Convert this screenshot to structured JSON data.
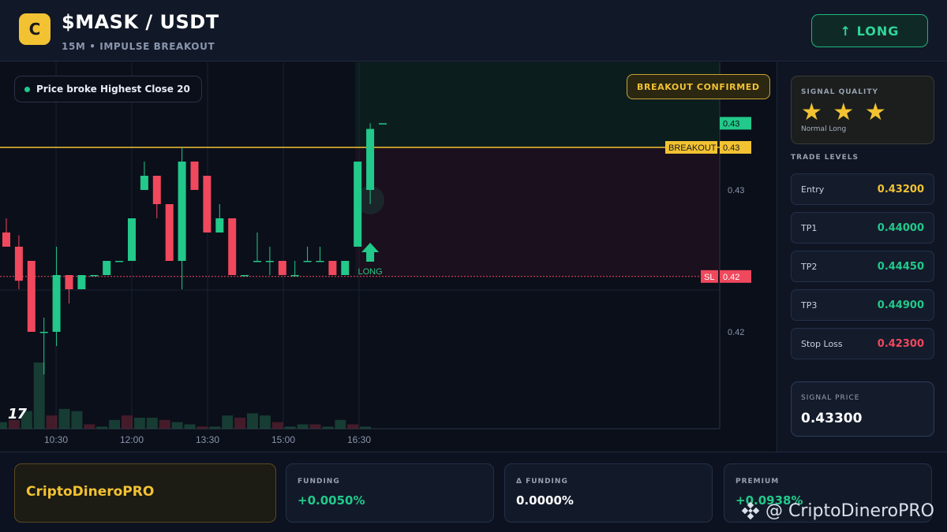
{
  "header": {
    "logo_letter": "C",
    "pair": "$MASK / USDT",
    "subtitle": "15M • IMPULSE BREAKOUT",
    "long_button": "↑ LONG"
  },
  "chart": {
    "status_pill": "Price broke Highest Close 20",
    "breakout_badge": "BREAKOUT CONFIRMED",
    "long_marker": "LONG",
    "tv_logo": "17",
    "price_labels": {
      "last": "0.43",
      "breakout_name": "BREAKOUT",
      "breakout_value": "0.43",
      "sl_name": "SL",
      "sl_value": "0.42"
    },
    "colors": {
      "up": "#22c98a",
      "down": "#f0485d",
      "breakout": "#f2c232",
      "sl": "#f0485d"
    }
  },
  "chart_data": {
    "type": "candlestick",
    "y_ticks": [
      0.42,
      0.43
    ],
    "y_tick_labels": [
      "0.42",
      "0.43"
    ],
    "x_tick_labels": [
      "10:30",
      "12:00",
      "13:30",
      "15:00",
      "16:30"
    ],
    "breakout_level": 0.433,
    "sl_level": 0.4239,
    "last_price": 0.4347,
    "ohlc": [
      [
        0.427,
        0.428,
        0.426,
        0.426
      ],
      [
        0.426,
        0.4268,
        0.423,
        0.4236
      ],
      [
        0.425,
        0.425,
        0.42,
        0.42
      ],
      [
        0.42,
        0.421,
        0.417,
        0.42
      ],
      [
        0.42,
        0.426,
        0.419,
        0.424
      ],
      [
        0.424,
        0.424,
        0.422,
        0.423
      ],
      [
        0.423,
        0.424,
        0.423,
        0.424
      ],
      [
        0.424,
        0.424,
        0.424,
        0.424
      ],
      [
        0.424,
        0.425,
        0.424,
        0.425
      ],
      [
        0.425,
        0.425,
        0.425,
        0.425
      ],
      [
        0.425,
        0.428,
        0.425,
        0.428
      ],
      [
        0.43,
        0.432,
        0.43,
        0.431
      ],
      [
        0.431,
        0.431,
        0.428,
        0.429
      ],
      [
        0.429,
        0.429,
        0.425,
        0.425
      ],
      [
        0.425,
        0.433,
        0.423,
        0.432
      ],
      [
        0.432,
        0.432,
        0.43,
        0.43
      ],
      [
        0.431,
        0.431,
        0.427,
        0.427
      ],
      [
        0.427,
        0.429,
        0.427,
        0.428
      ],
      [
        0.428,
        0.428,
        0.424,
        0.424
      ],
      [
        0.424,
        0.424,
        0.424,
        0.424
      ],
      [
        0.425,
        0.427,
        0.425,
        0.425
      ],
      [
        0.425,
        0.426,
        0.424,
        0.425
      ],
      [
        0.425,
        0.425,
        0.424,
        0.424
      ],
      [
        0.424,
        0.425,
        0.424,
        0.424
      ],
      [
        0.425,
        0.426,
        0.425,
        0.425
      ],
      [
        0.425,
        0.426,
        0.425,
        0.425
      ],
      [
        0.425,
        0.425,
        0.424,
        0.424
      ],
      [
        0.424,
        0.425,
        0.424,
        0.425
      ],
      [
        0.426,
        0.432,
        0.426,
        0.432
      ],
      [
        0.43,
        0.4347,
        0.429,
        0.4343
      ],
      [
        0.4347,
        0.4347,
        0.4347,
        0.4347
      ]
    ],
    "volume": [
      3,
      4,
      8,
      30,
      6,
      9,
      8,
      2,
      1,
      4,
      6,
      5,
      5,
      4,
      3,
      2,
      1,
      1,
      6,
      5,
      7,
      6,
      3,
      1,
      2,
      2,
      1,
      4,
      2,
      1,
      1,
      6,
      4,
      3,
      4,
      2,
      1,
      8,
      4,
      2
    ]
  },
  "sidebar": {
    "quality_label": "SIGNAL QUALITY",
    "stars": "★ ★ ★",
    "quality_kind": "Normal Long",
    "trade_levels_title": "TRADE LEVELS",
    "levels": [
      {
        "name": "Entry",
        "value": "0.43200",
        "color": "#f2c232"
      },
      {
        "name": "TP1",
        "value": "0.44000",
        "color": "#22c98a"
      },
      {
        "name": "TP2",
        "value": "0.44450",
        "color": "#22c98a"
      },
      {
        "name": "TP3",
        "value": "0.44900",
        "color": "#22c98a"
      },
      {
        "name": "Stop Loss",
        "value": "0.42300",
        "color": "#f0485d"
      }
    ],
    "signal_price_label": "SIGNAL PRICE",
    "signal_price": "0.43300"
  },
  "footer": {
    "brand": "CriptoDineroPRO",
    "stats": [
      {
        "label": "FUNDING",
        "value": "+0.0050%",
        "color": "#22c98a"
      },
      {
        "label": "Δ FUNDING",
        "value": "0.0000%",
        "color": "#ffffff"
      },
      {
        "label": "PREMIUM",
        "value": "+0.0938%",
        "color": "#22c98a"
      }
    ],
    "watermark": "@ CriptoDineroPRO"
  }
}
